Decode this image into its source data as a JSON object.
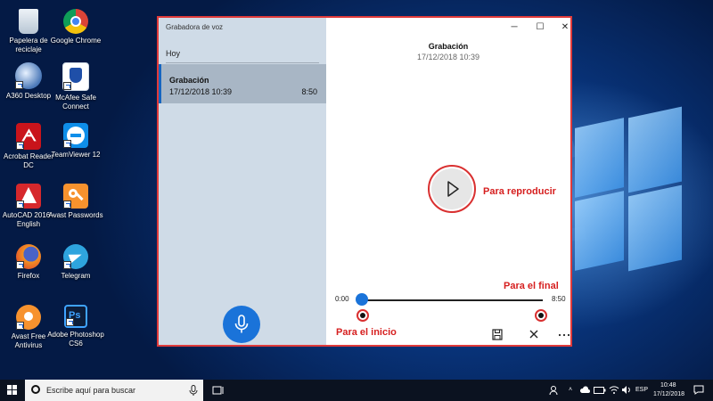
{
  "desktop": {
    "icons": [
      {
        "label": "Papelera de reciclaje",
        "icon": "recycle-bin-icon"
      },
      {
        "label": "Google Chrome",
        "icon": "chrome-icon"
      },
      {
        "label": "A360 Desktop",
        "icon": "a360-icon"
      },
      {
        "label": "McAfee Safe Connect",
        "icon": "mcafee-icon"
      },
      {
        "label": "Acrobat Reader DC",
        "icon": "acrobat-icon"
      },
      {
        "label": "TeamViewer 12",
        "icon": "teamviewer-icon"
      },
      {
        "label": "AutoCAD 2016 - English",
        "icon": "autocad-icon"
      },
      {
        "label": "Avast Passwords",
        "icon": "avast-passwords-icon"
      },
      {
        "label": "Firefox",
        "icon": "firefox-icon"
      },
      {
        "label": "Telegram",
        "icon": "telegram-icon"
      },
      {
        "label": "Avast Free Antivirus",
        "icon": "avast-icon"
      },
      {
        "label": "Adobe Photoshop CS6",
        "icon": "photoshop-icon"
      }
    ]
  },
  "app": {
    "title": "Grabadora de voz",
    "group_label": "Hoy",
    "recording": {
      "name": "Grabación",
      "date": "17/12/2018 10:39",
      "duration": "8:50"
    },
    "detail": {
      "title": "Grabación",
      "date": "17/12/2018 10:39"
    },
    "player": {
      "time_start": "0:00",
      "time_end": "8:50",
      "progress": 0
    },
    "window_controls": {
      "minimize": "─",
      "maximize": "☐",
      "close": "✕"
    },
    "actions": {
      "save": "💾",
      "delete": "✕",
      "more": "⋯"
    }
  },
  "annotations": {
    "play": "Para reproducir",
    "end": "Para el final",
    "start": "Para el inicio"
  },
  "taskbar": {
    "search_placeholder": "Escribe aquí para buscar",
    "language": "ESP",
    "time": "10:48",
    "date": "17/12/2018"
  },
  "colors": {
    "accent": "#1a73d9",
    "annotation": "#d93030"
  }
}
